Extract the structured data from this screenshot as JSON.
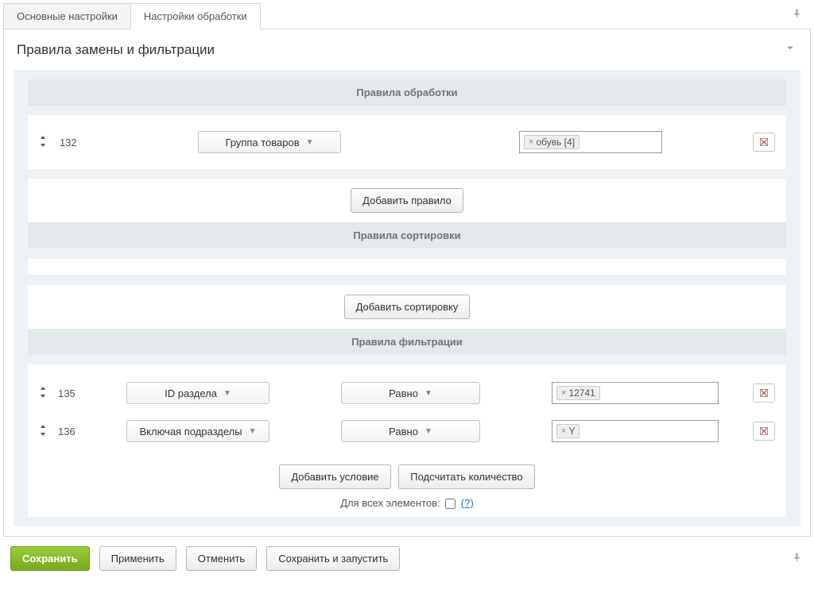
{
  "tabs": {
    "main": "Основные настройки",
    "processing": "Настройки обработки"
  },
  "panel": {
    "title": "Правила замены и фильтрации"
  },
  "sections": {
    "processing": "Правила обработки",
    "sorting": "Правила сортировки",
    "filtering": "Правила фильтрации"
  },
  "processing_rule": {
    "id": "132",
    "select_label": "Группа товаров",
    "token": "обувь [4]"
  },
  "buttons": {
    "add_rule": "Добавить правило",
    "add_sort": "Добавить сортировку",
    "add_condition": "Добавить условие",
    "count": "Подсчитать количество",
    "save": "Сохранить",
    "apply": "Применить",
    "cancel": "Отменить",
    "save_run": "Сохранить и запустить"
  },
  "filter_rules": [
    {
      "id": "135",
      "field": "ID раздела",
      "op": "Равно",
      "value": "12741"
    },
    {
      "id": "136",
      "field": "Включая подразделы",
      "op": "Равно",
      "value": "Y"
    }
  ],
  "for_all": {
    "label": "Для всех элементов:",
    "help": "(?)"
  }
}
